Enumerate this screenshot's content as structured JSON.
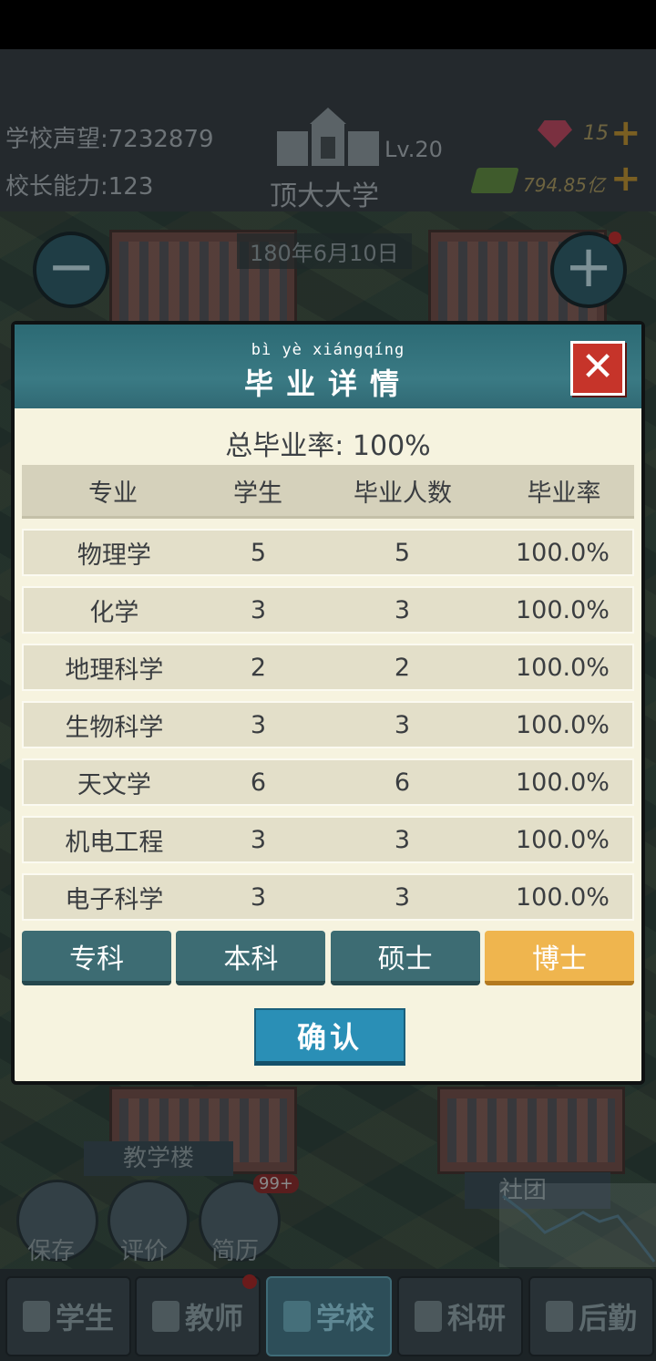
{
  "top": {
    "reputation_label": "学校声望:",
    "reputation_value": "7232879",
    "ability_label": "校长能力:",
    "ability_value": "123",
    "school_name": "顶大大学",
    "level": "Lv.20",
    "gems": "15",
    "money": "794.85",
    "money_unit": "亿",
    "date": "180年6月10日"
  },
  "map": {
    "building_label": "教学楼",
    "club_label": "社团",
    "save_label": "保存",
    "rate_label": "评价",
    "resume_label": "简历",
    "resume_badge": "99+"
  },
  "dialog": {
    "pinyin": "bì  yè  xiángqíng",
    "title": "毕业详情",
    "close": "✕",
    "overall_rate": "总毕业率:  100%",
    "headers": [
      "专业",
      "学生",
      "毕业人数",
      "毕业率"
    ],
    "rows": [
      [
        "物理学",
        "5",
        "5",
        "100.0%"
      ],
      [
        "化学",
        "3",
        "3",
        "100.0%"
      ],
      [
        "地理科学",
        "2",
        "2",
        "100.0%"
      ],
      [
        "生物科学",
        "3",
        "3",
        "100.0%"
      ],
      [
        "天文学",
        "6",
        "6",
        "100.0%"
      ],
      [
        "机电工程",
        "3",
        "3",
        "100.0%"
      ],
      [
        "电子科学",
        "3",
        "3",
        "100.0%"
      ]
    ],
    "degree_tabs": [
      "专科",
      "本科",
      "硕士",
      "博士"
    ],
    "active_tab": "博士",
    "confirm": "确认"
  },
  "nav": [
    "学生",
    "教师",
    "学校",
    "科研",
    "后勤"
  ],
  "colors": {
    "teal_header": "#3a7a84",
    "active_tab": "#efb54e",
    "confirm": "#2a8fb6",
    "close": "#c6342a"
  }
}
